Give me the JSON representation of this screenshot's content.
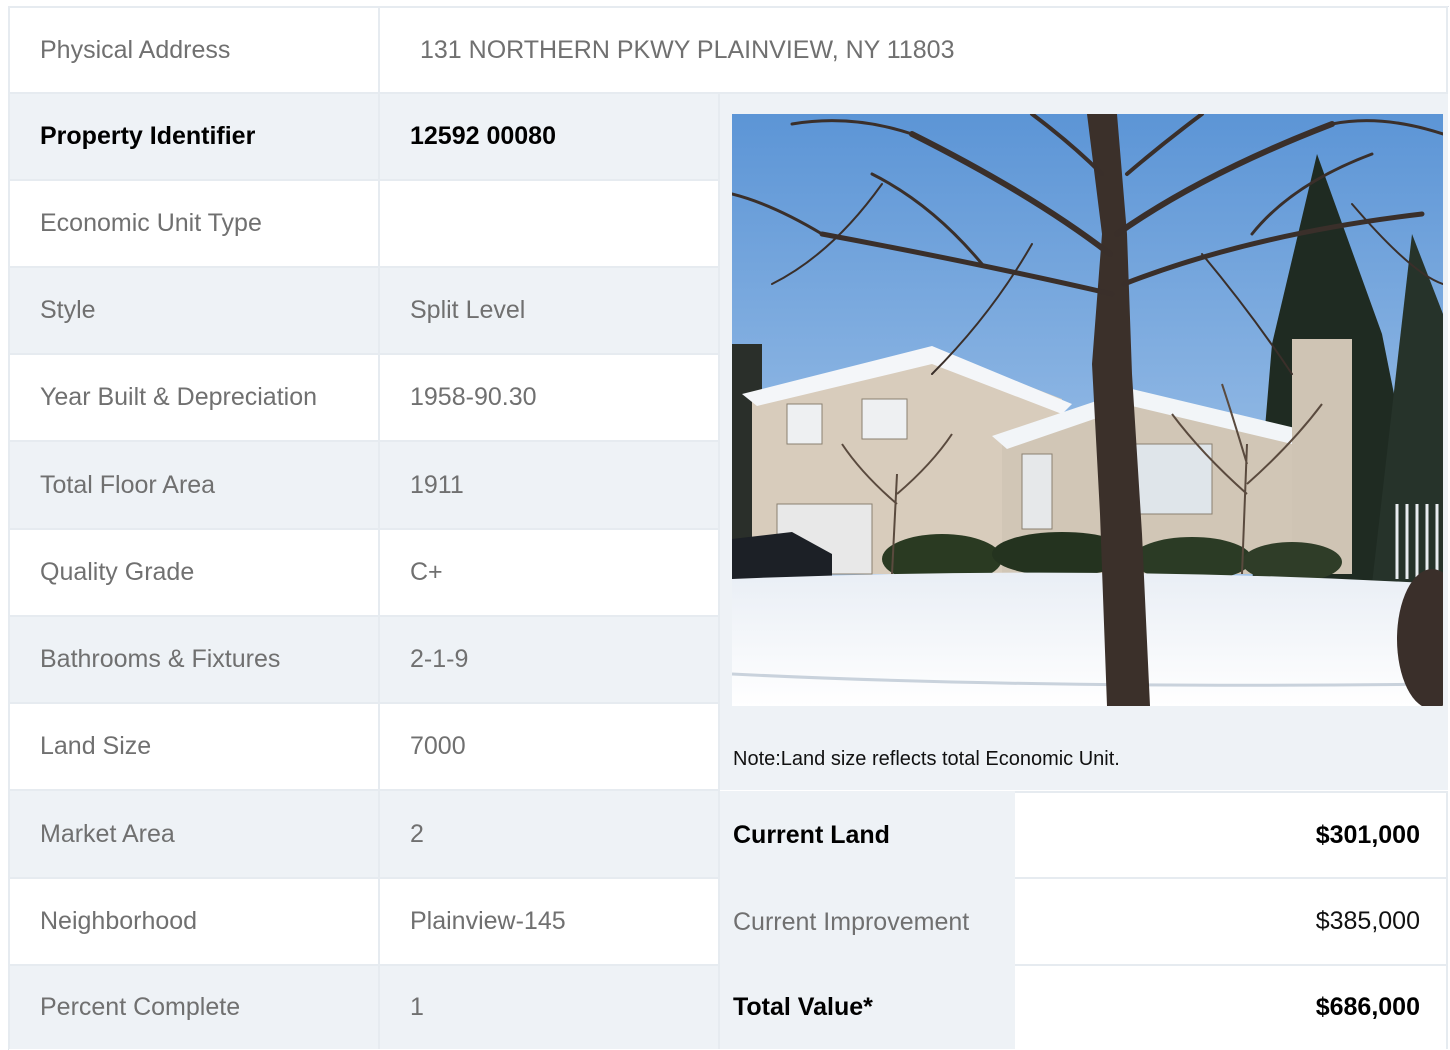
{
  "address": {
    "label": "Physical Address",
    "value": "131  NORTHERN PKWY  PLAINVIEW, NY  11803"
  },
  "details": [
    {
      "label": "Property Identifier",
      "value": "12592  00080"
    },
    {
      "label": "Economic Unit Type",
      "value": ""
    },
    {
      "label": "Style",
      "value": "Split Level"
    },
    {
      "label": "Year Built & Depreciation",
      "value": "1958-90.30"
    },
    {
      "label": "Total Floor Area",
      "value": "1911"
    },
    {
      "label": "Quality Grade",
      "value": "C+"
    },
    {
      "label": "Bathrooms & Fixtures",
      "value": "2-1-9"
    },
    {
      "label": "Land Size",
      "value": "7000"
    },
    {
      "label": "Market Area",
      "value": "2"
    },
    {
      "label": "Neighborhood",
      "value": "Plainview-145"
    },
    {
      "label": "Percent Complete",
      "value": "1"
    }
  ],
  "note": "Note:Land size reflects total Economic Unit.",
  "valuation": [
    {
      "label": "Current Land",
      "value": "$301,000"
    },
    {
      "label": "Current Improvement",
      "value": "$385,000"
    },
    {
      "label": "Total Value*",
      "value": "$686,000"
    }
  ],
  "colors": {
    "shade": "#eef2f6",
    "border": "#e6ebf0",
    "text": "#707070"
  }
}
